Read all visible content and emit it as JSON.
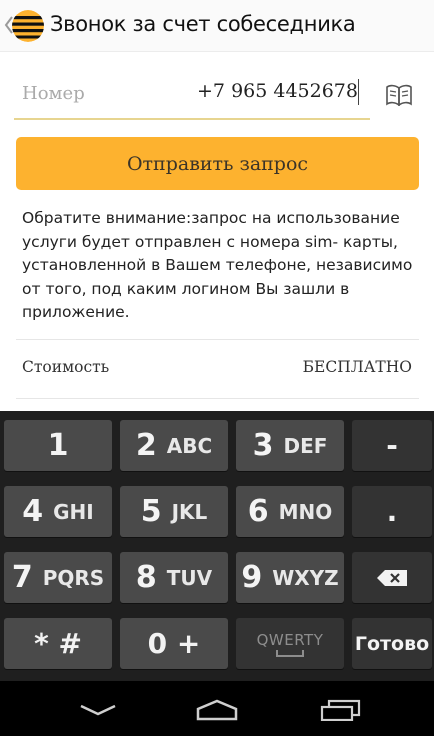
{
  "header": {
    "title": "Звонок за счет собеседника",
    "logo_icon": "beeline-logo",
    "brand_colors": {
      "yellow": "#fdb22f",
      "black": "#111111"
    }
  },
  "phone": {
    "placeholder": "Номер",
    "value": "+7 965 4452678",
    "contacts_icon": "book-icon"
  },
  "send_button": {
    "label": "Отправить запрос",
    "color": "#fdb22f"
  },
  "notice": "Обратите внимание:запрос на использование услуги будет отправлен с номера sim- карты, установленной в Вашем телефоне, независимо от того, под каким логином Вы зашли в приложение.",
  "cost": {
    "label": "Стоимость",
    "value": "БЕСПЛАТНО"
  },
  "keyboard": {
    "rows": [
      [
        {
          "d": "1",
          "l": ""
        },
        {
          "d": "2",
          "l": "ABC"
        },
        {
          "d": "3",
          "l": "DEF"
        },
        {
          "sym": "-"
        }
      ],
      [
        {
          "d": "4",
          "l": "GHI"
        },
        {
          "d": "5",
          "l": "JKL"
        },
        {
          "d": "6",
          "l": "MNO"
        },
        {
          "sym": "."
        }
      ],
      [
        {
          "d": "7",
          "l": "PQRS"
        },
        {
          "d": "8",
          "l": "TUV"
        },
        {
          "d": "9",
          "l": "WXYZ"
        },
        {
          "icon": "backspace-icon"
        }
      ],
      [
        {
          "sym": "* #"
        },
        {
          "sym": "0 +"
        },
        {
          "qwerty": "QWERTY"
        },
        {
          "done": "Готово"
        }
      ]
    ]
  },
  "navbar": {
    "icons": [
      "back-icon",
      "home-icon",
      "recent-apps-icon"
    ]
  }
}
